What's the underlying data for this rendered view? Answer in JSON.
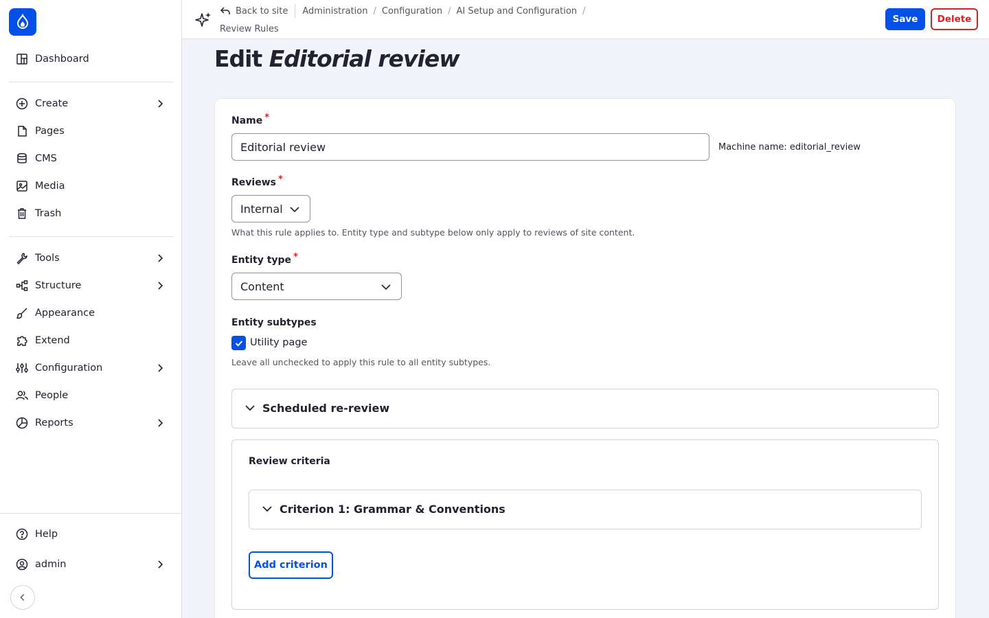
{
  "sidebar": {
    "items": [
      {
        "label": "Dashboard",
        "icon": "dashboard-icon"
      },
      {
        "label": "Create",
        "icon": "plus-circle-icon"
      },
      {
        "label": "Pages",
        "icon": "file-icon"
      },
      {
        "label": "CMS",
        "icon": "database-icon"
      },
      {
        "label": "Media",
        "icon": "image-icon"
      },
      {
        "label": "Trash",
        "icon": "trash-icon"
      },
      {
        "label": "Tools",
        "icon": "wrench-icon"
      },
      {
        "label": "Structure",
        "icon": "structure-icon"
      },
      {
        "label": "Appearance",
        "icon": "brush-icon"
      },
      {
        "label": "Extend",
        "icon": "puzzle-icon"
      },
      {
        "label": "Configuration",
        "icon": "sliders-icon"
      },
      {
        "label": "People",
        "icon": "people-icon"
      },
      {
        "label": "Reports",
        "icon": "chart-icon"
      }
    ],
    "help": "Help",
    "user": "admin"
  },
  "topbar": {
    "back": "Back to site",
    "crumbs": [
      "Administration",
      "Configuration",
      "AI Setup and Configuration"
    ],
    "crumb_current": "Review Rules",
    "save": "Save",
    "delete": "Delete"
  },
  "page": {
    "title_prefix": "Edit",
    "title_name": "Editorial review"
  },
  "form": {
    "name_label": "Name",
    "required_mark": "*",
    "name_value": "Editorial review",
    "machine_name": "Machine name: editorial_review",
    "reviews_label": "Reviews",
    "reviews_value": "Internal",
    "reviews_desc": "What this rule applies to. Entity type and subtype below only apply to reviews of site content.",
    "entity_type_label": "Entity type",
    "entity_type_value": "Content",
    "subtypes_label": "Entity subtypes",
    "subtype_option": "Utility page",
    "subtypes_desc": "Leave all unchecked to apply this rule to all entity subtypes.",
    "scheduled_summary": "Scheduled re-review",
    "criteria_title": "Review criteria",
    "criterion_1": "Criterion 1: Grammar & Conventions",
    "add_criterion": "Add criterion"
  },
  "colors": {
    "accent": "#0550e6",
    "danger": "#d72222"
  }
}
